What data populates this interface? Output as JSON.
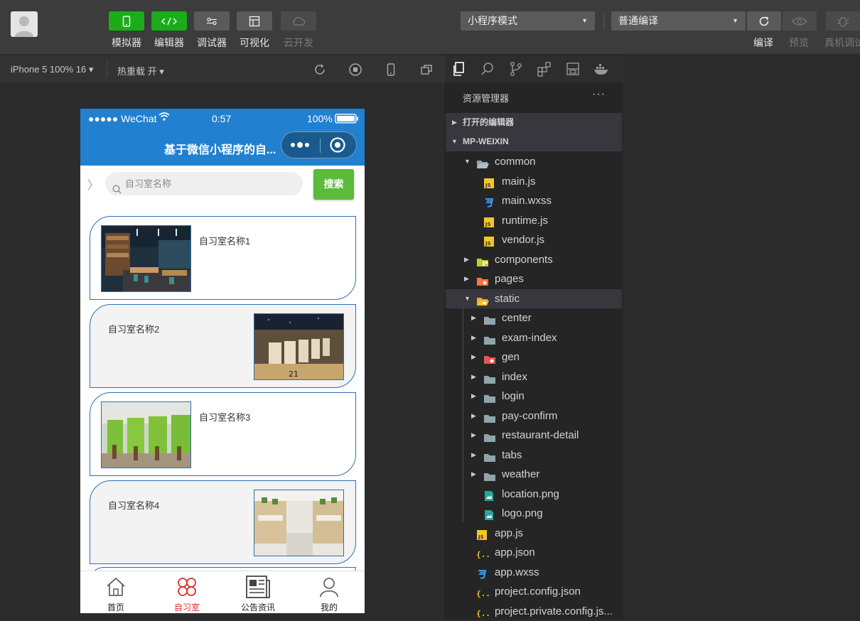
{
  "toolbar": {
    "buttons": [
      {
        "label": "模拟器",
        "icon": "phone-icon"
      },
      {
        "label": "编辑器",
        "icon": "code-icon"
      },
      {
        "label": "调试器",
        "icon": "debugger-icon"
      },
      {
        "label": "可视化",
        "icon": "layout-icon"
      },
      {
        "label": "云开发",
        "icon": "cloud-icon"
      }
    ],
    "mode_select": "小程序模式",
    "compile_select": "普通编译",
    "right_buttons": [
      {
        "label": "编译",
        "icon": "refresh-icon"
      },
      {
        "label": "预览",
        "icon": "eye-icon"
      },
      {
        "label": "真机调试",
        "icon": "bug-icon"
      }
    ]
  },
  "simbar": {
    "device": "iPhone 5 100% 16 ▾",
    "hot_reload": "热重载 开 ▾"
  },
  "phone": {
    "status": {
      "carrier": "●●●●● WeChat",
      "time": "0:57",
      "battery": "100%"
    },
    "nav_title": "基于微信小程序的自...",
    "search_placeholder": "自习室名称",
    "search_button": "搜索",
    "back_glyph": "〉",
    "rooms": [
      {
        "name": "自习室名称1"
      },
      {
        "name": "自习室名称2"
      },
      {
        "name": "自习室名称3"
      },
      {
        "name": "自习室名称4"
      }
    ],
    "tabs": [
      {
        "label": "首页",
        "active": false
      },
      {
        "label": "自习室",
        "active": true
      },
      {
        "label": "公告资讯",
        "active": false
      },
      {
        "label": "我的",
        "active": false
      }
    ]
  },
  "explorer": {
    "title": "资源管理器",
    "more": "···",
    "sections": {
      "open_editors": "打开的编辑器",
      "project": "MP-WEIXIN"
    },
    "tree": [
      {
        "name": "common",
        "type": "folder-open",
        "expanded": true
      },
      {
        "name": "main.js",
        "type": "js"
      },
      {
        "name": "main.wxss",
        "type": "css"
      },
      {
        "name": "runtime.js",
        "type": "js"
      },
      {
        "name": "vendor.js",
        "type": "js"
      },
      {
        "name": "components",
        "type": "folder-components"
      },
      {
        "name": "pages",
        "type": "folder-pages"
      },
      {
        "name": "static",
        "type": "folder-static",
        "expanded": true
      },
      {
        "name": "center",
        "type": "folder"
      },
      {
        "name": "exam-index",
        "type": "folder"
      },
      {
        "name": "gen",
        "type": "folder-red"
      },
      {
        "name": "index",
        "type": "folder"
      },
      {
        "name": "login",
        "type": "folder"
      },
      {
        "name": "pay-confirm",
        "type": "folder"
      },
      {
        "name": "restaurant-detail",
        "type": "folder"
      },
      {
        "name": "tabs",
        "type": "folder"
      },
      {
        "name": "weather",
        "type": "folder"
      },
      {
        "name": "location.png",
        "type": "image"
      },
      {
        "name": "logo.png",
        "type": "image"
      },
      {
        "name": "app.js",
        "type": "js"
      },
      {
        "name": "app.json",
        "type": "json"
      },
      {
        "name": "app.wxss",
        "type": "css"
      },
      {
        "name": "project.config.json",
        "type": "json"
      },
      {
        "name": "project.private.config.js...",
        "type": "json"
      }
    ]
  }
}
